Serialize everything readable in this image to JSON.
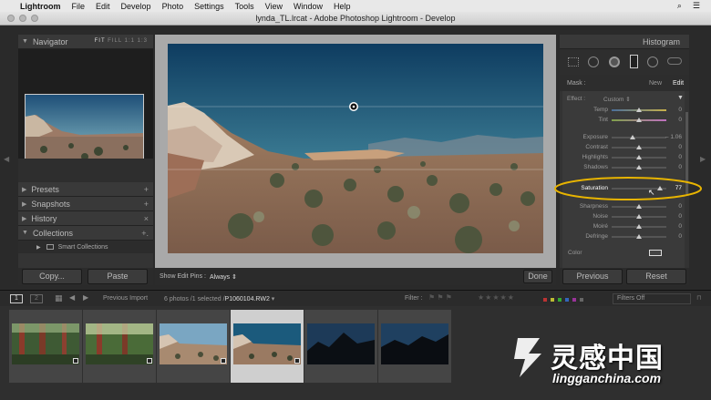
{
  "menubar": {
    "items": [
      "Lightroom",
      "File",
      "Edit",
      "Develop",
      "Photo",
      "Settings",
      "Tools",
      "View",
      "Window",
      "Help"
    ]
  },
  "window": {
    "title": "lynda_TL.lrcat - Adobe Photoshop Lightroom - Develop"
  },
  "left_panel": {
    "navigator": {
      "label": "Navigator",
      "zoom": [
        "FIT",
        "FILL",
        "1:1",
        "1:3"
      ]
    },
    "sections": [
      {
        "label": "Presets",
        "action": "+"
      },
      {
        "label": "Snapshots",
        "action": "+"
      },
      {
        "label": "History",
        "action": "×"
      },
      {
        "label": "Collections",
        "action": "+."
      }
    ],
    "smart_collections": "Smart Collections",
    "copy_button": "Copy...",
    "paste_button": "Paste"
  },
  "toolbar": {
    "show_edit_pins_label": "Show Edit Pins :",
    "show_edit_pins_value": "Always",
    "done_button": "Done"
  },
  "right_panel": {
    "histogram_label": "Histogram",
    "mask_label": "Mask :",
    "mask_new": "New",
    "mask_edit": "Edit",
    "effect_label": "Effect :",
    "effect_value": "Custom",
    "sliders": [
      {
        "label": "Temp",
        "value": "0",
        "pos": 0.5
      },
      {
        "label": "Tint",
        "value": "0",
        "pos": 0.5
      },
      {
        "label": "Exposure",
        "value": "– 1.06",
        "pos": 0.39
      },
      {
        "label": "Contrast",
        "value": "0",
        "pos": 0.5
      },
      {
        "label": "Highlights",
        "value": "0",
        "pos": 0.5
      },
      {
        "label": "Shadows",
        "value": "0",
        "pos": 0.5
      },
      {
        "label": "Saturation",
        "value": "77",
        "pos": 0.88
      },
      {
        "label": "Sharpness",
        "value": "0",
        "pos": 0.5
      },
      {
        "label": "Noise",
        "value": "0",
        "pos": 0.5
      },
      {
        "label": "Moiré",
        "value": "0",
        "pos": 0.5
      },
      {
        "label": "Defringe",
        "value": "0",
        "pos": 0.5
      }
    ],
    "color_label": "Color",
    "previous_button": "Previous",
    "reset_button": "Reset"
  },
  "filmstrip_bar": {
    "page1": "1",
    "page2": "2",
    "source": "Previous Import",
    "info": "6 photos /1 selected /",
    "filename": "P1060104.RW2",
    "filter_label": "Filter :",
    "filters_off": "Filters Off"
  },
  "watermark": {
    "brand": "灵感中国",
    "url": "lingganchina.com"
  },
  "colors": {
    "highlight_ellipse": "#e8b400",
    "accent_tint": "#c070c0",
    "accent_temp": "#7fa04a"
  }
}
